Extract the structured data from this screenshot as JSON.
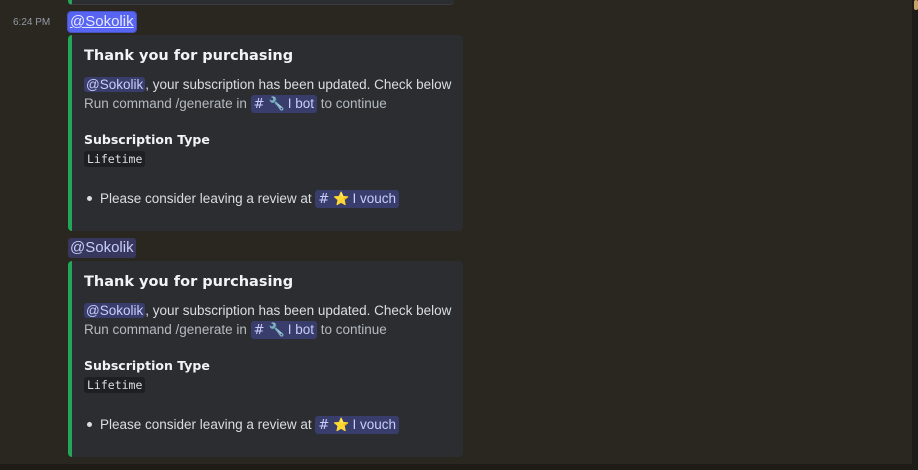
{
  "messages": [
    {
      "timestamp": "6:24 PM",
      "mention": "@Sokolik",
      "embed": {
        "title": "Thank you for purchasing",
        "desc_mention": "@Sokolik",
        "desc_text": ", your subscription has been updated. Check below",
        "run_prefix": "Run command /generate in ",
        "run_channel_hash": "#",
        "run_channel_icon": "wrench-icon",
        "run_channel_emoji": "🔧",
        "run_channel_name": "I bot",
        "run_suffix": " to continue",
        "field_name": "Subscription Type",
        "field_value": "Lifetime",
        "bullet_text": "Please consider leaving a review at ",
        "review_channel_hash": "#",
        "review_channel_icon": "star-icon",
        "review_channel_emoji": "⭐",
        "review_channel_name": "I vouch"
      }
    },
    {
      "mention": "@Sokolik",
      "embed": {
        "title": "Thank you for purchasing",
        "desc_mention": "@Sokolik",
        "desc_text": ", your subscription has been updated. Check below",
        "run_prefix": "Run command /generate in ",
        "run_channel_hash": "#",
        "run_channel_icon": "wrench-icon",
        "run_channel_emoji": "🔧",
        "run_channel_name": "I bot",
        "run_suffix": " to continue",
        "field_name": "Subscription Type",
        "field_value": "Lifetime",
        "bullet_text": "Please consider leaving a review at ",
        "review_channel_hash": "#",
        "review_channel_icon": "star-icon",
        "review_channel_emoji": "⭐",
        "review_channel_name": "I vouch"
      }
    }
  ],
  "colors": {
    "background": "#2a2620",
    "embed_background": "#2b2d31",
    "embed_accent": "#23a55a",
    "mention_background": "#5865f2",
    "mention_text": "#c9cdfb"
  }
}
